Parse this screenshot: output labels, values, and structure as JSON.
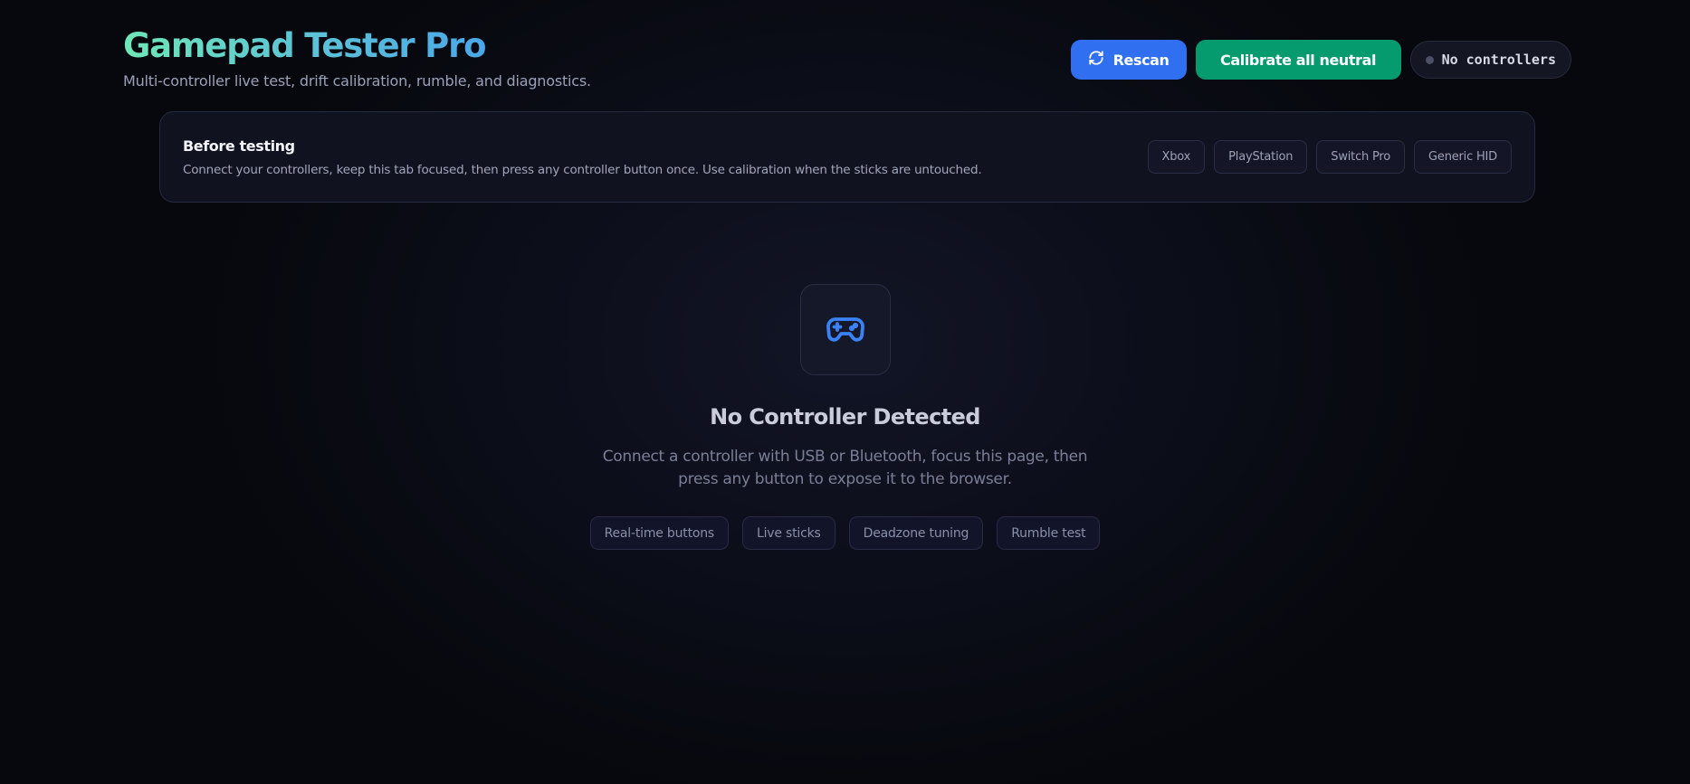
{
  "header": {
    "title": "Gamepad Tester Pro",
    "subtitle": "Multi-controller live test, drift calibration, rumble, and diagnostics.",
    "rescan_label": "Rescan",
    "calibrate_label": "Calibrate all neutral",
    "status_text": "No controllers"
  },
  "notice": {
    "title": "Before testing",
    "text": "Connect your controllers, keep this tab focused, then press any controller button once. Use calibration when the sticks are untouched.",
    "tags": [
      "Xbox",
      "PlayStation",
      "Switch Pro",
      "Generic HID"
    ]
  },
  "empty_state": {
    "title": "No Controller Detected",
    "text": "Connect a controller with USB or Bluetooth, focus this page, then press any button to expose it to the browser.",
    "features": [
      "Real-time buttons",
      "Live sticks",
      "Deadzone tuning",
      "Rumble test"
    ]
  },
  "icons": {
    "rescan": "refresh-icon",
    "empty": "gamepad-icon",
    "status": "status-dot-icon"
  },
  "colors": {
    "accent_blue": "#2f6ff0",
    "accent_green": "#069b6e",
    "title_gradient_start": "#6ee7b7",
    "title_gradient_end": "#4aa8e8",
    "gamepad_icon": "#3b82f6"
  }
}
